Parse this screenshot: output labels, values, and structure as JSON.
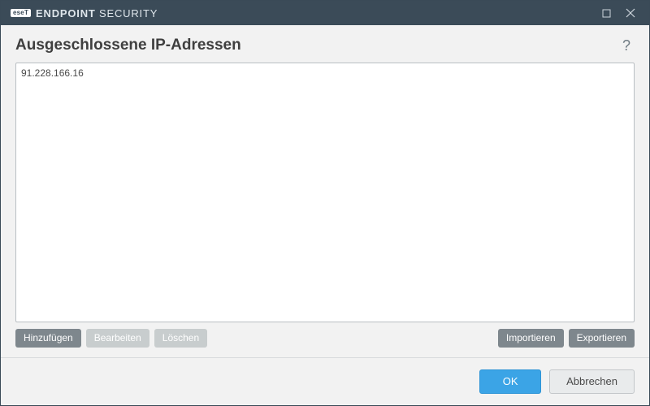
{
  "titlebar": {
    "badge": "eseT",
    "brand_bold": "ENDPOINT",
    "brand_rest": "SECURITY"
  },
  "header": {
    "title": "Ausgeschlossene IP-Adressen",
    "help": "?"
  },
  "list": {
    "items": [
      "91.228.166.16"
    ]
  },
  "toolbar": {
    "add": "Hinzufügen",
    "edit": "Bearbeiten",
    "delete": "Löschen",
    "import": "Importieren",
    "export": "Exportieren"
  },
  "footer": {
    "ok": "OK",
    "cancel": "Abbrechen"
  }
}
